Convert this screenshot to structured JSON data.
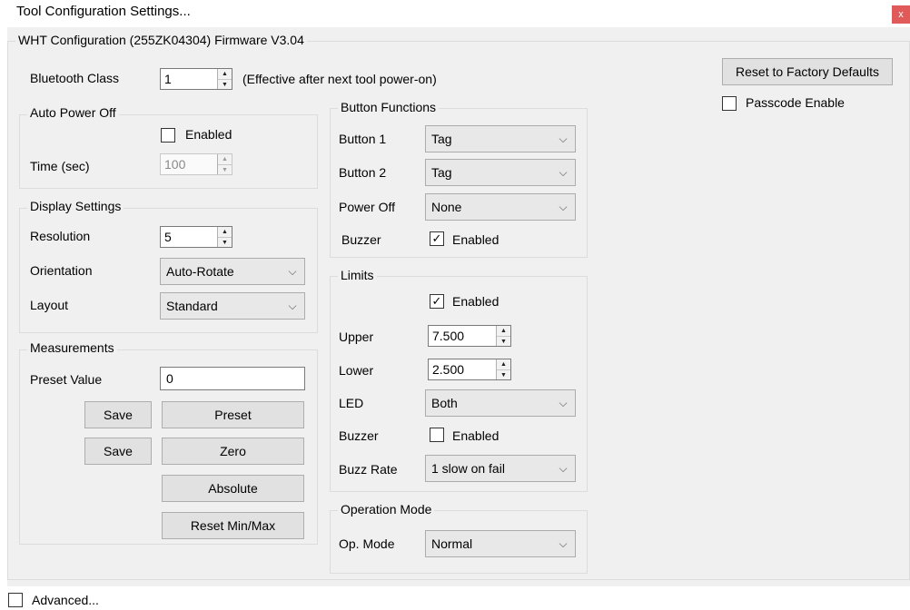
{
  "window": {
    "title": "Tool Configuration Settings...",
    "close_glyph": "x"
  },
  "group_main": {
    "title": "WHT Configuration (255ZK04304) Firmware V3.04"
  },
  "bluetooth": {
    "label": "Bluetooth Class",
    "value": "1",
    "note": "(Effective after next tool power-on)"
  },
  "auto_power_off": {
    "title": "Auto Power Off",
    "enabled_label": "Enabled",
    "enabled_mark": "",
    "time_label": "Time (sec)",
    "time_value": "100"
  },
  "display_settings": {
    "title": "Display Settings",
    "resolution_label": "Resolution",
    "resolution_value": "5",
    "orientation_label": "Orientation",
    "orientation_value": "Auto-Rotate",
    "layout_label": "Layout",
    "layout_value": "Standard"
  },
  "measurements": {
    "title": "Measurements",
    "preset_label": "Preset Value",
    "preset_value": "0",
    "save1_label": "Save",
    "save2_label": "Save",
    "preset_button": "Preset",
    "zero_button": "Zero",
    "absolute_button": "Absolute",
    "reset_minmax_button": "Reset Min/Max"
  },
  "button_functions": {
    "title": "Button Functions",
    "button1_label": "Button 1",
    "button1_value": "Tag",
    "button2_label": "Button 2",
    "button2_value": "Tag",
    "poweroff_label": "Power Off",
    "poweroff_value": "None",
    "buzzer_label": "Buzzer",
    "buzzer_enabled_label": "Enabled",
    "buzzer_mark": "✓"
  },
  "limits": {
    "title": "Limits",
    "enabled_label": "Enabled",
    "enabled_mark": "✓",
    "upper_label": "Upper",
    "upper_value": "7.500",
    "lower_label": "Lower",
    "lower_value": "2.500",
    "led_label": "LED",
    "led_value": "Both",
    "buzzer_label": "Buzzer",
    "buzzer_enabled_label": "Enabled",
    "buzzer_mark": "",
    "buzzrate_label": "Buzz Rate",
    "buzzrate_value": "1 slow on fail"
  },
  "operation_mode": {
    "title": "Operation Mode",
    "opmode_label": "Op. Mode",
    "opmode_value": "Normal"
  },
  "right_panel": {
    "reset_button": "Reset to Factory Defaults",
    "passcode_label": "Passcode Enable",
    "passcode_mark": ""
  },
  "footer": {
    "advanced_label": "Advanced...",
    "advanced_mark": ""
  },
  "glyphs": {
    "spin_up": "▲",
    "spin_down": "▼",
    "chevron": "⌵"
  },
  "colors": {
    "close_button": "#e05a5a",
    "dialog_background": "#f0f0f0"
  }
}
